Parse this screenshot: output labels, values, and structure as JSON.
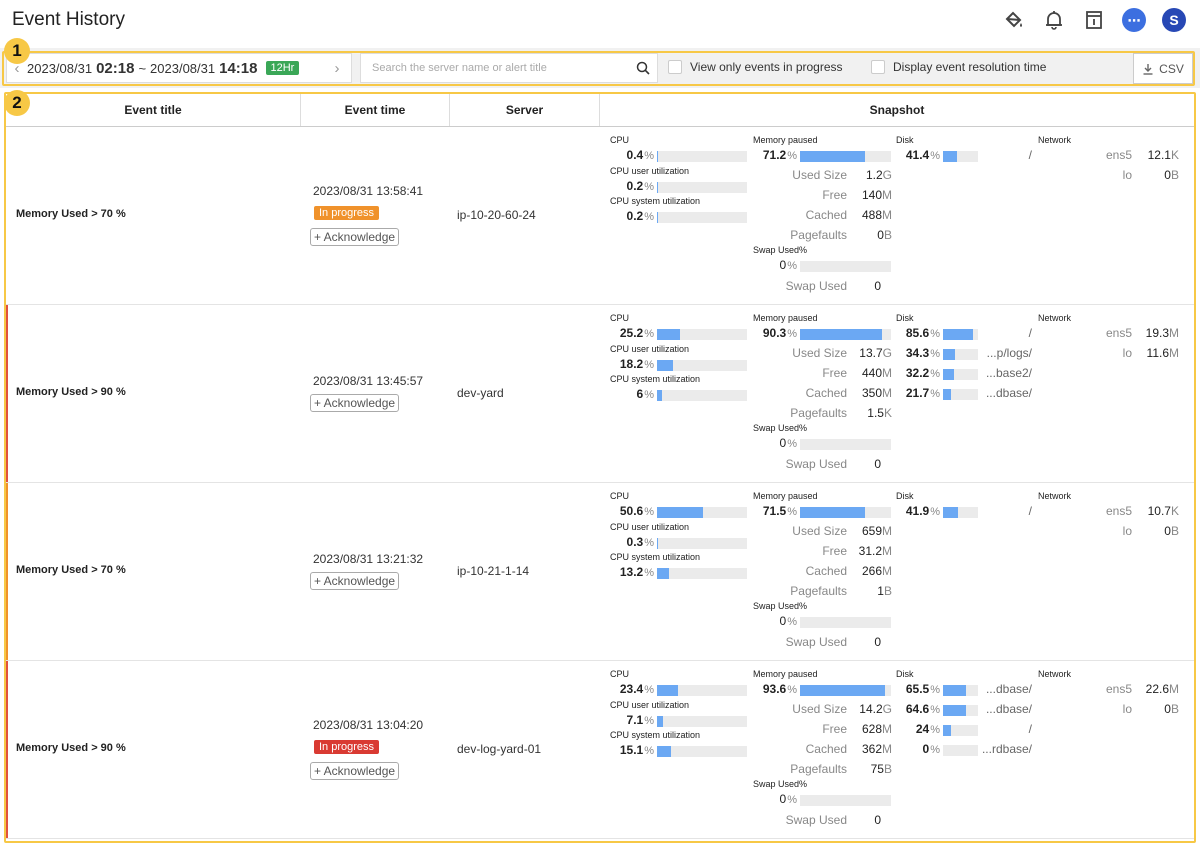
{
  "header": {
    "title": "Event History"
  },
  "toolbar": {
    "date_start_day": "2023/08/31",
    "date_start_time": "02:18",
    "date_end_day": "2023/08/31",
    "date_end_time": "14:18",
    "range_badge": "12Hr",
    "search_placeholder": "Search the server name or alert title",
    "check_in_progress": "View only events in progress",
    "check_resolution": "Display event resolution time",
    "csv_label": "CSV",
    "callout_1": "1",
    "callout_2": "2"
  },
  "table": {
    "columns": [
      "Event title",
      "Event time",
      "Server",
      "Snapshot"
    ]
  },
  "snapshot_labels": {
    "cpu": "CPU",
    "cpu_user": "CPU user utilization",
    "cpu_system": "CPU system utilization",
    "memory": "Memory paused",
    "used_size": "Used Size",
    "free": "Free",
    "cached": "Cached",
    "pagefaults": "Pagefaults",
    "swap_used_pct": "Swap Used%",
    "swap_used": "Swap Used",
    "disk": "Disk",
    "network": "Network",
    "ack_label": "+ Acknowledge"
  },
  "rows": [
    {
      "title": "Memory Used > 70 %",
      "time": "2023/08/31 13:58:41",
      "status": "In progress",
      "status_color": "#f0922b",
      "stripe_color": "",
      "server": "ip-10-20-60-24",
      "cpu": "0.4",
      "cpu_user": "0.2",
      "cpu_system": "0.2",
      "mem": "71.2",
      "used_size": "1.2",
      "used_size_u": "G",
      "free": "140",
      "free_u": "M",
      "cached": "488",
      "cached_u": "M",
      "pagefaults": "0",
      "pagefaults_u": "B",
      "swap_pct": "0",
      "swap_used": "0",
      "disks": [
        {
          "pct": "41.4",
          "path": "/"
        }
      ],
      "net": [
        {
          "name": "ens5",
          "val": "12.1",
          "u": "K"
        },
        {
          "name": "lo",
          "val": "0",
          "u": "B"
        }
      ]
    },
    {
      "title": "Memory Used > 90 %",
      "time": "2023/08/31 13:45:57",
      "status": "",
      "status_color": "",
      "stripe_color": "#e0513f",
      "server": "dev-yard",
      "cpu": "25.2",
      "cpu_user": "18.2",
      "cpu_system": "6",
      "mem": "90.3",
      "used_size": "13.7",
      "used_size_u": "G",
      "free": "440",
      "free_u": "M",
      "cached": "350",
      "cached_u": "M",
      "pagefaults": "1.5",
      "pagefaults_u": "K",
      "swap_pct": "0",
      "swap_used": "0",
      "disks": [
        {
          "pct": "85.6",
          "path": "/"
        },
        {
          "pct": "34.3",
          "path": "...p/logs/"
        },
        {
          "pct": "32.2",
          "path": "...base2/"
        },
        {
          "pct": "21.7",
          "path": "...dbase/"
        }
      ],
      "net": [
        {
          "name": "ens5",
          "val": "19.3",
          "u": "M"
        },
        {
          "name": "lo",
          "val": "11.6",
          "u": "M"
        }
      ]
    },
    {
      "title": "Memory Used > 70 %",
      "time": "2023/08/31 13:21:32",
      "status": "",
      "status_color": "",
      "stripe_color": "#f0922b",
      "server": "ip-10-21-1-14",
      "cpu": "50.6",
      "cpu_user": "0.3",
      "cpu_system": "13.2",
      "mem": "71.5",
      "used_size": "659",
      "used_size_u": "M",
      "free": "31.2",
      "free_u": "M",
      "cached": "266",
      "cached_u": "M",
      "pagefaults": "1",
      "pagefaults_u": "B",
      "swap_pct": "0",
      "swap_used": "0",
      "disks": [
        {
          "pct": "41.9",
          "path": "/"
        }
      ],
      "net": [
        {
          "name": "ens5",
          "val": "10.7",
          "u": "K"
        },
        {
          "name": "lo",
          "val": "0",
          "u": "B"
        }
      ]
    },
    {
      "title": "Memory Used > 90 %",
      "time": "2023/08/31 13:04:20",
      "status": "In progress",
      "status_color": "#d93a32",
      "stripe_color": "#e0513f",
      "server": "dev-log-yard-01",
      "cpu": "23.4",
      "cpu_user": "7.1",
      "cpu_system": "15.1",
      "mem": "93.6",
      "used_size": "14.2",
      "used_size_u": "G",
      "free": "628",
      "free_u": "M",
      "cached": "362",
      "cached_u": "M",
      "pagefaults": "75",
      "pagefaults_u": "B",
      "swap_pct": "0",
      "swap_used": "0",
      "disks": [
        {
          "pct": "65.5",
          "path": "...dbase/"
        },
        {
          "pct": "64.6",
          "path": "...dbase/"
        },
        {
          "pct": "24",
          "path": "/"
        },
        {
          "pct": "0",
          "path": "...rdbase/"
        }
      ],
      "net": [
        {
          "name": "ens5",
          "val": "22.6",
          "u": "M"
        },
        {
          "name": "lo",
          "val": "0",
          "u": "B"
        }
      ]
    }
  ]
}
